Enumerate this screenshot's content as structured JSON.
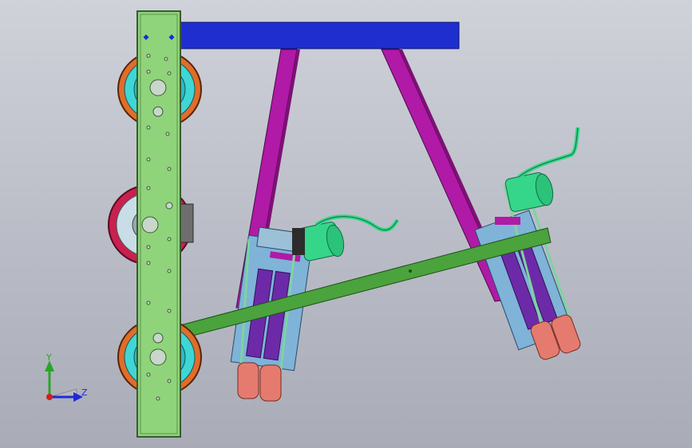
{
  "viewport": {
    "background_top": "#cfd2d9",
    "background_bottom": "#a9acb6"
  },
  "model": {
    "colors": {
      "frame_green": "#8fd47a",
      "crossbar_blue": "#1f2fcf",
      "strut_magenta": "#b01aa6",
      "diagonal_green": "#4aa33c",
      "wheel_orange": "#e06d2a",
      "wheel_cyan": "#3fd6d6",
      "wheel_crimson": "#c8214f",
      "motor_green": "#36d68a",
      "track_purple": "#6d2aa8",
      "roller_salmon": "#e57b6e"
    }
  },
  "triad": {
    "y_label": "Y",
    "z_label": "Z",
    "y_color": "#2aa52a",
    "z_color": "#1e2ad8",
    "origin_color": "#d21e1e"
  }
}
